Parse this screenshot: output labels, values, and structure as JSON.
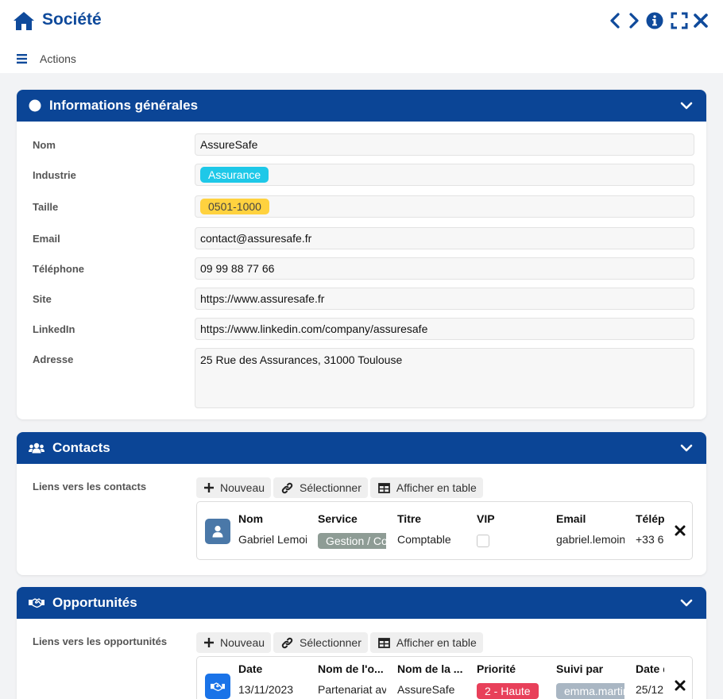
{
  "header": {
    "title": "Société",
    "menu_label": "Actions"
  },
  "info": {
    "title": "Informations générales",
    "fields": {
      "nom": {
        "label": "Nom",
        "value": "AssureSafe"
      },
      "industrie": {
        "label": "Industrie",
        "value": "Assurance"
      },
      "taille": {
        "label": "Taille",
        "value": "0501-1000"
      },
      "email": {
        "label": "Email",
        "value": "contact@assuresafe.fr"
      },
      "telephone": {
        "label": "Téléphone",
        "value": "09 99 88 77 66"
      },
      "site": {
        "label": "Site",
        "value": "https://www.assuresafe.fr"
      },
      "linkedin": {
        "label": "LinkedIn",
        "value": "https://www.linkedin.com/company/assuresafe"
      },
      "adresse": {
        "label": "Adresse",
        "value": "25 Rue des Assurances, 31000 Toulouse"
      }
    }
  },
  "toolbar": {
    "new_label": "Nouveau",
    "select_label": "Sélectionner",
    "table_label": "Afficher en table"
  },
  "contacts": {
    "title": "Contacts",
    "link_label": "Liens vers les contacts",
    "columns": [
      "Nom",
      "Service",
      "Titre",
      "VIP",
      "Email",
      "Télép"
    ],
    "row": {
      "nom": "Gabriel Lemoin",
      "service": "Gestion / Co",
      "titre": "Comptable",
      "vip": false,
      "email": "gabriel.lemoin",
      "telephone": "+33 6"
    }
  },
  "opportunites": {
    "title": "Opportunités",
    "link_label": "Liens vers les opportunités",
    "columns": [
      "Date",
      "Nom de l'o...",
      "Nom de la ...",
      "Priorité",
      "Suivi par",
      "Date d"
    ],
    "row": {
      "date": "13/11/2023",
      "nom_opportunite": "Partenariat ave",
      "nom_societe": "AssureSafe",
      "priorite": "2 - Haute",
      "suivi_par": "emma.martin",
      "date2": "25/12"
    }
  },
  "colors": {
    "brand": "#0b4596",
    "title": "#0f4a9b",
    "industry_tag": "#1ec8e8",
    "size_tag": "#ffd23f",
    "service_tag": "#8e9c95",
    "priority_tag": "#e8405a",
    "follower_tag": "#a9b6c3",
    "contact_avatar": "#4a78a8",
    "opportunity_avatar": "#1a73e8"
  },
  "icons": [
    "home-icon",
    "chevron-left-icon",
    "chevron-right-icon",
    "info-icon",
    "fullscreen-icon",
    "close-icon",
    "hamburger-icon",
    "circle-icon",
    "users-icon",
    "handshake-icon",
    "chevron-down-icon",
    "plus-icon",
    "link-icon",
    "table-icon",
    "user-icon",
    "remove-icon"
  ]
}
